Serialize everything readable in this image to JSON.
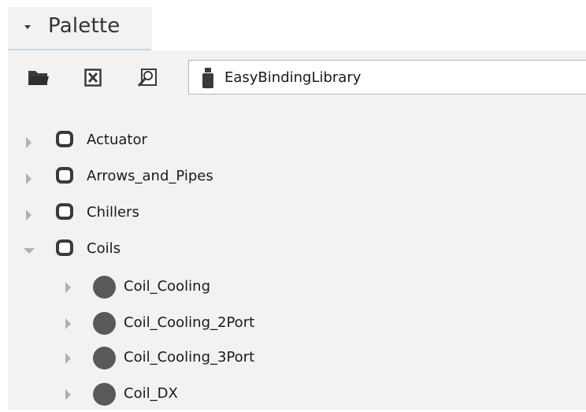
{
  "palette": {
    "tab_title": "Palette"
  },
  "toolbar": {
    "open_icon": "folder-open-icon",
    "close_icon": "close-box-icon",
    "find_icon": "find-icon",
    "library_icon": "library-jar-icon",
    "library_name": "EasyBindingLibrary"
  },
  "tree": {
    "folders": [
      {
        "label": "Actuator",
        "expanded": false
      },
      {
        "label": "Arrows_and_Pipes",
        "expanded": false
      },
      {
        "label": "Chillers",
        "expanded": false
      },
      {
        "label": "Coils",
        "expanded": true
      }
    ],
    "coil_items": [
      {
        "label": "Coil_Cooling"
      },
      {
        "label": "Coil_Cooling_2Port"
      },
      {
        "label": "Coil_Cooling_3Port"
      },
      {
        "label": "Coil_DX"
      }
    ]
  },
  "colors": {
    "tab_underline": "#c3d8ea",
    "panel_background": "#f2f2f2",
    "expander": "#b0b0b0",
    "icon_dark": "#3a3a3a"
  }
}
